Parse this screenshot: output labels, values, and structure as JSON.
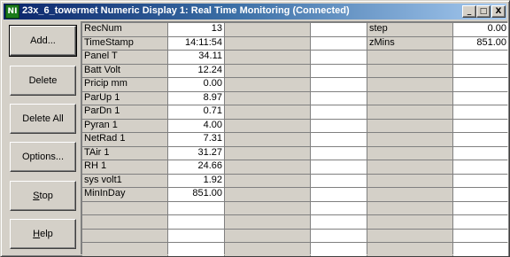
{
  "window": {
    "title": "23x_6_towermet Numeric Display 1: Real Time Monitoring (Connected)",
    "app_icon_text": "NI",
    "controls": {
      "minimize": "_",
      "maximize": "□",
      "close": "X"
    }
  },
  "buttons": [
    {
      "id": "add",
      "label": "Add..."
    },
    {
      "id": "delete",
      "label": "Delete"
    },
    {
      "id": "delete-all",
      "label": "Delete All"
    },
    {
      "id": "options",
      "label": "Options..."
    },
    {
      "id": "stop",
      "label": "Stop"
    },
    {
      "id": "help",
      "label": "Help"
    }
  ],
  "grid": {
    "columns": 3,
    "rows": 17,
    "col1": [
      {
        "name": "RecNum",
        "value": "13"
      },
      {
        "name": "TimeStamp",
        "value": "14:11:54"
      },
      {
        "name": "Panel  T",
        "value": "34.11"
      },
      {
        "name": "Batt  Volt",
        "value": "12.24"
      },
      {
        "name": "Pricip  mm",
        "value": "0.00"
      },
      {
        "name": "ParUp  1",
        "value": "8.97"
      },
      {
        "name": "ParDn  1",
        "value": "0.71"
      },
      {
        "name": "Pyran  1",
        "value": "4.00"
      },
      {
        "name": "NetRad  1",
        "value": "7.31"
      },
      {
        "name": "TAir  1",
        "value": "31.27"
      },
      {
        "name": "RH  1",
        "value": "24.66"
      },
      {
        "name": "sys  volt1",
        "value": "1.92"
      },
      {
        "name": "MinInDay",
        "value": "851.00"
      }
    ],
    "col2": [],
    "col3": [
      {
        "name": "step",
        "value": "0.00"
      },
      {
        "name": "zMins",
        "value": "851.00"
      }
    ]
  }
}
